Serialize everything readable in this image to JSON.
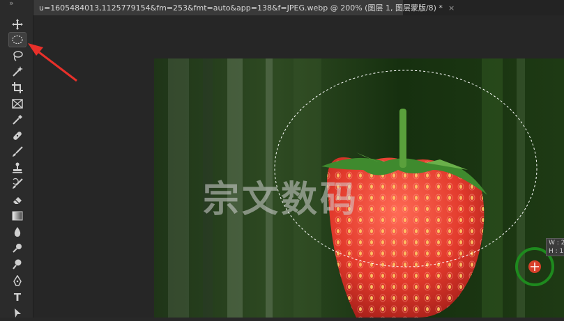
{
  "document_tab": {
    "title": "u=1605484013,1125779154&fm=253&fmt=auto&app=138&f=JPEG.webp @ 200% (图层 1, 图层蒙版/8) *",
    "close_glyph": "×"
  },
  "toolbar": {
    "collapse_glyph": "»",
    "tools": [
      {
        "name": "move-tool",
        "icon": "move-icon"
      },
      {
        "name": "elliptical-marquee-tool",
        "icon": "ellipse-marquee-icon",
        "active": true
      },
      {
        "name": "lasso-tool",
        "icon": "lasso-icon"
      },
      {
        "name": "magic-wand-tool",
        "icon": "magic-wand-icon"
      },
      {
        "name": "crop-tool",
        "icon": "crop-icon"
      },
      {
        "name": "frame-tool",
        "icon": "frame-icon"
      },
      {
        "name": "eyedropper-tool",
        "icon": "eyedropper-icon"
      },
      {
        "name": "healing-brush-tool",
        "icon": "bandage-icon"
      },
      {
        "name": "brush-tool",
        "icon": "brush-icon"
      },
      {
        "name": "clone-stamp-tool",
        "icon": "stamp-icon"
      },
      {
        "name": "history-brush-tool",
        "icon": "history-brush-icon"
      },
      {
        "name": "eraser-tool",
        "icon": "eraser-icon"
      },
      {
        "name": "gradient-tool",
        "icon": "gradient-icon"
      },
      {
        "name": "blur-tool",
        "icon": "drop-icon"
      },
      {
        "name": "dodge-tool",
        "icon": "dodge-icon"
      },
      {
        "name": "pen-tool",
        "icon": "pen-icon"
      },
      {
        "name": "type-tool",
        "icon": "type-icon",
        "label": "T"
      },
      {
        "name": "path-selection-tool",
        "icon": "arrow-select-icon"
      }
    ]
  },
  "canvas": {
    "watermark": "宗文数码",
    "size_tooltip": {
      "w": "W : 2",
      "h": "H : 1"
    }
  },
  "colors": {
    "accent_arrow": "#e8302a",
    "cursor_ring": "#1e8a1e",
    "cursor_center": "#d8402a"
  }
}
